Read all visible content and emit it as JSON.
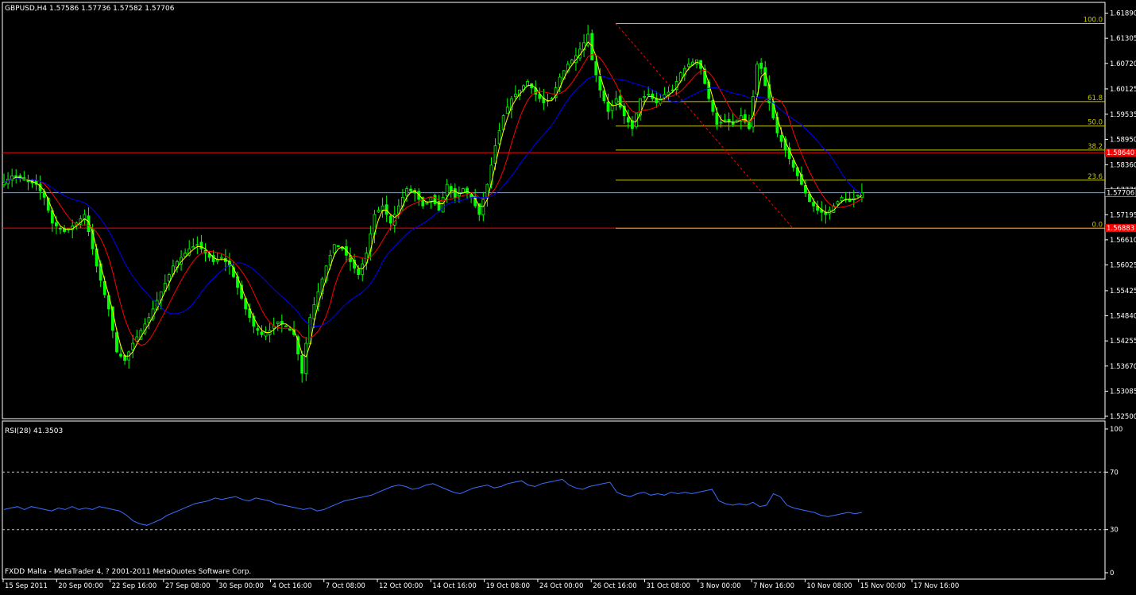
{
  "header": {
    "symbol_line": "GBPUSD,H4  1.57586 1.57736 1.57582 1.57706",
    "rsi_line": "RSI(28) 41.3503",
    "footer": "FXDD Malta - MetaTrader 4, ? 2001-2011 MetaQuotes Software Corp."
  },
  "colors": {
    "background": "#000000",
    "candles": "#00ff00",
    "ma_fast": "#ffff00",
    "ma_mid": "#ff0000",
    "ma_slow": "#0000ff",
    "fib": "#c8c800",
    "sr_lines": "#ff0000",
    "current_price_line": "#8ea6bf",
    "rsi_line": "#3b6eff",
    "grid_text": "#ffffff"
  },
  "chart_data": [
    {
      "type": "candlestick",
      "title": "GBPUSD,H4",
      "ohlc_last": {
        "open": 1.57586,
        "high": 1.57736,
        "low": 1.57582,
        "close": 1.57706
      },
      "ylim": [
        1.525,
        1.619
      ],
      "y_ticks": [
        "1.61890",
        "1.61305",
        "1.60720",
        "1.60125",
        "1.59535",
        "1.58950",
        "1.58360",
        "1.57770",
        "1.57195",
        "1.56610",
        "1.56025",
        "1.55425",
        "1.54840",
        "1.54255",
        "1.53670",
        "1.53085",
        "1.52500"
      ],
      "x_ticks": [
        "15 Sep 2011",
        "20 Sep 00:00",
        "22 Sep 16:00",
        "27 Sep 08:00",
        "30 Sep 00:00",
        "4 Oct 16:00",
        "7 Oct 08:00",
        "12 Oct 00:00",
        "14 Oct 16:00",
        "19 Oct 08:00",
        "24 Oct 00:00",
        "26 Oct 16:00",
        "31 Oct 08:00",
        "3 Nov 00:00",
        "7 Nov 16:00",
        "10 Nov 08:00",
        "15 Nov 00:00",
        "17 Nov 16:00"
      ],
      "close_path": [
        [
          0,
          1.5795
        ],
        [
          2,
          1.581
        ],
        [
          5,
          1.58
        ],
        [
          8,
          1.579
        ],
        [
          10,
          1.576
        ],
        [
          12,
          1.57
        ],
        [
          15,
          1.568
        ],
        [
          18,
          1.57
        ],
        [
          20,
          1.572
        ],
        [
          23,
          1.56
        ],
        [
          26,
          1.55
        ],
        [
          28,
          1.54
        ],
        [
          30,
          1.538
        ],
        [
          32,
          1.542
        ],
        [
          34,
          1.545
        ],
        [
          36,
          1.548
        ],
        [
          38,
          1.552
        ],
        [
          40,
          1.556
        ],
        [
          42,
          1.56
        ],
        [
          44,
          1.562
        ],
        [
          46,
          1.564
        ],
        [
          48,
          1.565
        ],
        [
          50,
          1.563
        ],
        [
          52,
          1.561
        ],
        [
          54,
          1.562
        ],
        [
          56,
          1.56
        ],
        [
          58,
          1.555
        ],
        [
          60,
          1.55
        ],
        [
          62,
          1.546
        ],
        [
          64,
          1.544
        ],
        [
          66,
          1.545
        ],
        [
          68,
          1.547
        ],
        [
          70,
          1.546
        ],
        [
          72,
          1.544
        ],
        [
          74,
          1.535
        ],
        [
          75,
          1.542
        ],
        [
          76,
          1.548
        ],
        [
          78,
          1.554
        ],
        [
          80,
          1.56
        ],
        [
          82,
          1.565
        ],
        [
          84,
          1.564
        ],
        [
          86,
          1.561
        ],
        [
          88,
          1.558
        ],
        [
          90,
          1.563
        ],
        [
          92,
          1.572
        ],
        [
          94,
          1.574
        ],
        [
          96,
          1.57
        ],
        [
          98,
          1.574
        ],
        [
          100,
          1.578
        ],
        [
          102,
          1.577
        ],
        [
          104,
          1.574
        ],
        [
          106,
          1.576
        ],
        [
          108,
          1.573
        ],
        [
          110,
          1.579
        ],
        [
          112,
          1.576
        ],
        [
          114,
          1.578
        ],
        [
          116,
          1.576
        ],
        [
          118,
          1.572
        ],
        [
          120,
          1.579
        ],
        [
          122,
          1.588
        ],
        [
          124,
          1.595
        ],
        [
          126,
          1.599
        ],
        [
          128,
          1.601
        ],
        [
          130,
          1.603
        ],
        [
          132,
          1.6
        ],
        [
          134,
          1.598
        ],
        [
          136,
          1.599
        ],
        [
          138,
          1.604
        ],
        [
          140,
          1.607
        ],
        [
          142,
          1.609
        ],
        [
          144,
          1.612
        ],
        [
          145,
          1.614
        ],
        [
          146,
          1.608
        ],
        [
          148,
          1.601
        ],
        [
          150,
          1.596
        ],
        [
          152,
          1.599
        ],
        [
          154,
          1.595
        ],
        [
          156,
          1.592
        ],
        [
          158,
          1.599
        ],
        [
          160,
          1.6
        ],
        [
          162,
          1.598
        ],
        [
          164,
          1.6
        ],
        [
          166,
          1.601
        ],
        [
          168,
          1.605
        ],
        [
          170,
          1.607
        ],
        [
          172,
          1.608
        ],
        [
          173,
          1.606
        ],
        [
          175,
          1.599
        ],
        [
          177,
          1.593
        ],
        [
          179,
          1.594
        ],
        [
          181,
          1.593
        ],
        [
          183,
          1.595
        ],
        [
          185,
          1.592
        ],
        [
          187,
          1.607
        ],
        [
          188,
          1.606
        ],
        [
          190,
          1.598
        ],
        [
          192,
          1.591
        ],
        [
          194,
          1.587
        ],
        [
          196,
          1.583
        ],
        [
          198,
          1.579
        ],
        [
          200,
          1.575
        ],
        [
          202,
          1.573
        ],
        [
          204,
          1.572
        ],
        [
          206,
          1.574
        ],
        [
          208,
          1.576
        ],
        [
          210,
          1.575
        ],
        [
          212,
          1.5765
        ],
        [
          213,
          1.5771
        ]
      ],
      "fibonacci": {
        "high": 1.6165,
        "low": 1.5688,
        "levels": [
          {
            "label": "100.0",
            "price": 1.6165
          },
          {
            "label": "61.8",
            "price": 1.5983
          },
          {
            "label": "50.0",
            "price": 1.5926
          },
          {
            "label": "38.2",
            "price": 1.587
          },
          {
            "label": "23.6",
            "price": 1.58
          },
          {
            "label": "0.0",
            "price": 1.5688
          }
        ]
      },
      "horizontal_lines": [
        {
          "price": 1.5864,
          "label": "1.58640",
          "kind": "resistance"
        },
        {
          "price": 1.56883,
          "label": "1.56883",
          "kind": "support"
        },
        {
          "price": 1.57706,
          "label": "1.57706",
          "kind": "current"
        }
      ]
    },
    {
      "type": "line",
      "title": "RSI(28) 41.3503",
      "ylim": [
        0,
        100
      ],
      "y_ticks": [
        "100",
        "70",
        "30",
        "0"
      ],
      "levels": [
        70,
        30
      ],
      "series": [
        {
          "values": [
            44,
            45,
            46,
            44,
            46,
            45,
            44,
            43,
            45,
            44,
            46,
            44,
            45,
            44,
            46,
            45,
            44,
            43,
            40,
            36,
            34,
            33,
            35,
            37,
            40,
            42,
            44,
            46,
            48,
            49,
            50,
            52,
            51,
            52,
            53,
            51,
            50,
            52,
            51,
            50,
            48,
            47,
            46,
            45,
            44,
            45,
            43,
            44,
            46,
            48,
            50,
            51,
            52,
            53,
            54,
            56,
            58,
            60,
            61,
            60,
            58,
            59,
            61,
            62,
            60,
            58,
            56,
            55,
            57,
            59,
            60,
            61,
            59,
            60,
            62,
            63,
            64,
            61,
            60,
            62,
            63,
            64,
            65,
            61,
            59,
            58,
            60,
            61,
            62,
            63,
            56,
            54,
            53,
            55,
            56,
            54,
            55,
            54,
            56,
            55,
            56,
            55,
            56,
            57,
            58,
            50,
            48,
            47,
            48,
            47,
            49,
            46,
            47,
            55,
            53,
            47,
            45,
            44,
            43,
            42,
            40,
            39,
            40,
            41,
            42,
            41,
            42
          ]
        }
      ]
    }
  ]
}
